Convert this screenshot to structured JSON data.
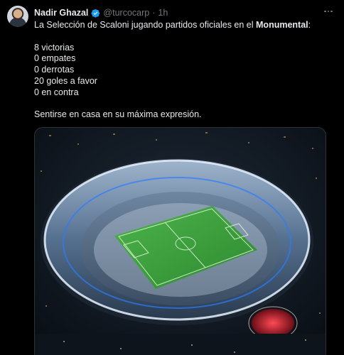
{
  "tweet": {
    "author_name": "Nadir Ghazal",
    "handle": "@turcocarp",
    "separator": "·",
    "time": "1h",
    "text_intro": "La Selección de Scaloni jugando partidos oficiales en el ",
    "text_bold": "Monumental",
    "text_colon": ":",
    "stats": [
      "8 victorias",
      "0 empates",
      "0 derrotas",
      "20 goles a favor",
      "0 en contra"
    ],
    "closing": "Sentirse en casa en su máxima expresión."
  },
  "icons": {
    "verified": "verified-badge-icon",
    "more": "more-options-icon"
  },
  "colors": {
    "verified": "#1d9bf0",
    "secondary_text": "#71767b",
    "pitch": "#3aa13a"
  }
}
